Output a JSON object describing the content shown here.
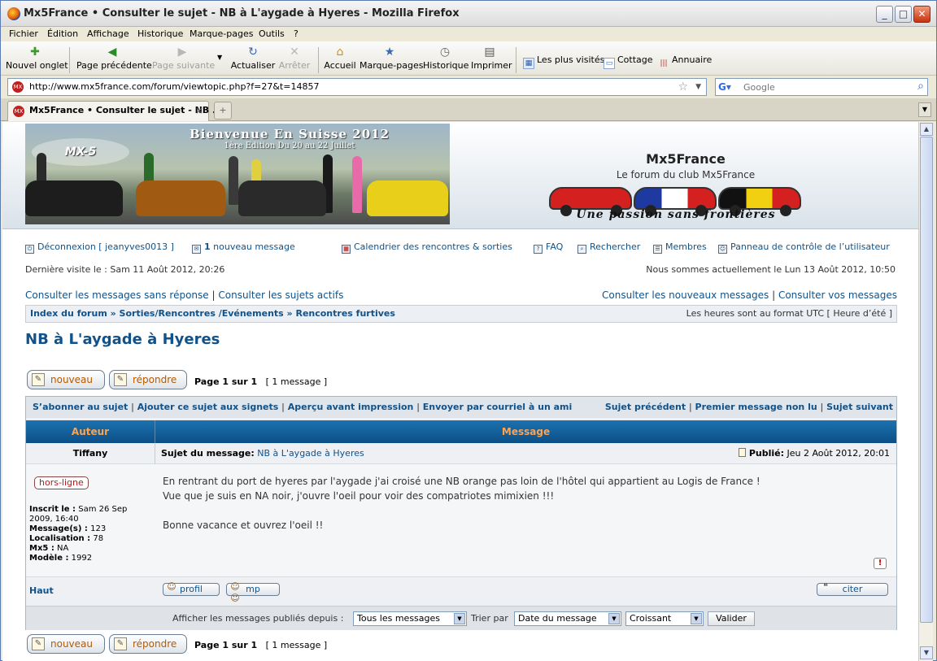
{
  "window": {
    "title": "Mx5France • Consulter le sujet - NB à L'aygade à Hyeres - Mozilla Firefox",
    "min": "_",
    "max": "□",
    "close": "✕"
  },
  "menu": [
    "Fichier",
    "Édition",
    "Affichage",
    "Historique",
    "Marque-pages",
    "Outils",
    "?"
  ],
  "toolbar": {
    "new_tab": "Nouvel onglet",
    "back": "Page précédente",
    "forward": "Page suivante",
    "reload": "Actualiser",
    "stop": "Arrêter",
    "home": "Accueil",
    "bookmarks": "Marque-pages",
    "history": "Historique",
    "print": "Imprimer",
    "most_visited": "Les plus visités",
    "cottage": "Cottage",
    "annuaire": "Annuaire"
  },
  "urlbar": {
    "url": "http://www.mx5france.com/forum/viewtopic.php?f=27&t=14857",
    "search_placeholder": "Google"
  },
  "tab": {
    "label": "Mx5France • Consulter le sujet - NB ...",
    "close": "×",
    "new": "+"
  },
  "banner": {
    "photo_title": "Bienvenue En Suisse 2012",
    "photo_sub": "1ère Edition Du 20 au 22 Juillet",
    "logo": "MX-5",
    "site_title": "Mx5France",
    "site_sub": "Le forum du club Mx5France",
    "slogan": "Une passion sans frontières"
  },
  "nav": {
    "logout": "Déconnexion [ jeanyves0013 ]",
    "new_msg_count": "1",
    "new_msg": "nouveau message",
    "calendar": "Calendrier des rencontres & sorties",
    "faq": "FAQ",
    "search": "Rechercher",
    "members": "Membres",
    "ucp": "Panneau de contrôle de l’utilisateur",
    "last_visit": "Dernière visite le : Sam 11 Août 2012, 20:26",
    "now": "Nous sommes actuellement le Lun 13 Août 2012, 10:50",
    "unanswered": "Consulter les messages sans réponse",
    "active": "Consulter les sujets actifs",
    "new_posts": "Consulter les nouveaux messages",
    "your_posts": "Consulter vos messages",
    "sep": "|",
    "breadcrumb": "Index du forum » Sorties/Rencontres /Evénements » Rencontres furtives",
    "timezone": "Les heures sont au format UTC [ Heure d’été ]"
  },
  "topic": {
    "title": "NB à L'aygade à Hyeres",
    "new_btn": "nouveau",
    "reply_btn": "répondre",
    "page": "Page 1 sur 1",
    "count": "[ 1 message ]"
  },
  "actions": {
    "left": [
      "S’abonner au sujet",
      "Ajouter ce sujet aux signets",
      "Aperçu avant impression",
      "Envoyer par courriel à un ami"
    ],
    "right": [
      "Sujet précédent",
      "Premier message non lu",
      "Sujet suivant"
    ]
  },
  "table": {
    "col_author": "Auteur",
    "col_message": "Message"
  },
  "post": {
    "author": "Tiffany",
    "subject_label": "Sujet du message:",
    "subject": "NB à L'aygade à Hyeres",
    "published_label": "Publié:",
    "published": "Jeu 2 Août 2012, 20:01",
    "status": "hors-ligne",
    "profile": [
      {
        "k": "Inscrit le :",
        "v": "Sam 26 Sep 2009, 16:40"
      },
      {
        "k": "Message(s) :",
        "v": "123"
      },
      {
        "k": "Localisation :",
        "v": "78"
      },
      {
        "k": "Mx5 :",
        "v": "NA"
      },
      {
        "k": "Modèle :",
        "v": "1992"
      }
    ],
    "body": [
      "En rentrant du port de hyeres par l'aygade j'ai croisé une NB orange pas loin de l'hôtel qui appartient au Logis de France !",
      "Vue que je suis en NA noir, j'ouvre l'oeil pour voir des compatriotes mimixien !!!",
      "",
      "Bonne vacance et ouvrez l'oeil !!"
    ],
    "top": "Haut",
    "profil_btn": "profil",
    "mp_btn": "mp",
    "quote_btn": "citer",
    "report": "!"
  },
  "sort": {
    "label1": "Afficher les messages publiés depuis :",
    "sel1": "Tous les messages",
    "label2": "Trier par",
    "sel2": "Date du message",
    "sel3": "Croissant",
    "submit": "Valider"
  },
  "colors": {
    "link": "#105289",
    "header_start": "#1c72b0",
    "header_end": "#0c4f86",
    "header_text": "#ffa34f",
    "offline": "#b21c1c"
  }
}
